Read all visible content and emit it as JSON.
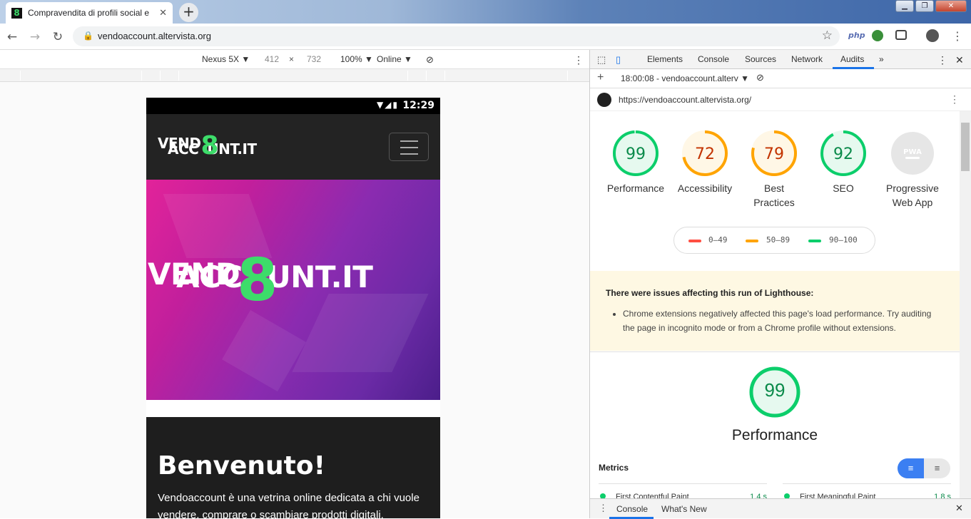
{
  "browser": {
    "tab_title": "Compravendita di profili social e",
    "favicon_char": "8",
    "url": "vendoaccount.altervista.org",
    "new_tab": "+",
    "ext_php": "php"
  },
  "device_toolbar": {
    "device": "Nexus 5X ▼",
    "width": "412",
    "times": "×",
    "height": "732",
    "zoom": "100% ▼",
    "network": "Online ▼"
  },
  "phone": {
    "time": "12:29",
    "logo_line1_a": "VEND",
    "logo_eight": "8",
    "logo_line2_a": "ACC",
    "logo_line2_b": "UNT.IT",
    "heading": "Benvenuto!",
    "paragraph": "Vendoaccount è una vetrina online dedicata a chi vuole vendere, comprare o scambiare prodotti digitali."
  },
  "devtools": {
    "tabs": [
      "Elements",
      "Console",
      "Sources",
      "Network",
      "Audits"
    ],
    "more": "»",
    "run_label": "18:00:08 - vendoaccount.alterv ▼",
    "report_url": "https://vendoaccount.altervista.org/",
    "gauges": [
      {
        "score": "99",
        "label": "Performance",
        "label2": "",
        "color": "#0cce6b",
        "fill": "#e6f9ef",
        "fraction": 0.99
      },
      {
        "score": "72",
        "label": "Accessibility",
        "label2": "",
        "color": "#ffa400",
        "fill": "#fff7e6",
        "fraction": 0.72
      },
      {
        "score": "79",
        "label": "Best",
        "label2": "Practices",
        "color": "#ffa400",
        "fill": "#fff7e6",
        "fraction": 0.79
      },
      {
        "score": "92",
        "label": "SEO",
        "label2": "",
        "color": "#0cce6b",
        "fill": "#e6f9ef",
        "fraction": 0.92
      },
      {
        "score": "PWA",
        "label": "Progressive",
        "label2": "Web App",
        "color": "#cccccc",
        "fill": "#e6e6e6",
        "fraction": 0
      }
    ],
    "legend": [
      {
        "range": "0–49",
        "color": "#ff4e42"
      },
      {
        "range": "50–89",
        "color": "#ffa400"
      },
      {
        "range": "90–100",
        "color": "#0cce6b"
      }
    ],
    "warning_title": "There were issues affecting this run of Lighthouse:",
    "warning_item": "Chrome extensions negatively affected this page's load performance. Try auditing the page in incognito mode or from a Chrome profile without extensions.",
    "big_score": "99",
    "big_label": "Performance",
    "metrics_title": "Metrics",
    "metric1_name": "First Contentful Paint",
    "metric1_value": "1.4 s",
    "metric2_name": "First Meaningful Paint",
    "metric2_value": "1.8 s",
    "drawer_tabs": [
      "Console",
      "What's New"
    ]
  }
}
